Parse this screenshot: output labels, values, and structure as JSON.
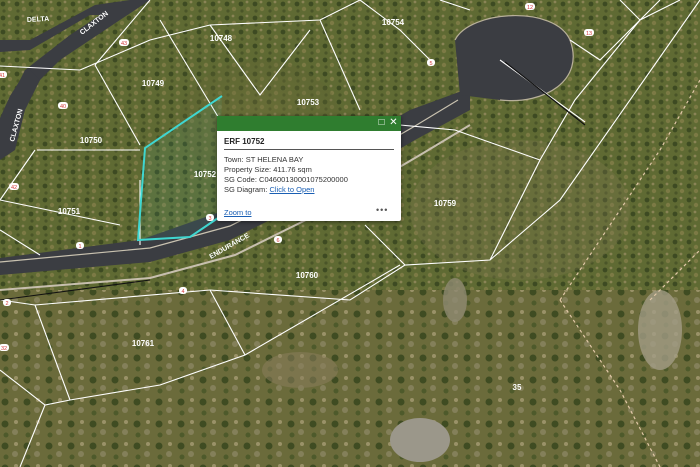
{
  "map": {
    "erf_labels": [
      "10754",
      "10748",
      "10749",
      "10753",
      "10750",
      "10751",
      "10759",
      "10760",
      "10761",
      "35",
      "10752"
    ],
    "street_names": [
      "DELTA",
      "CLAXTON",
      "CLAXTON",
      "ENDURANCE"
    ],
    "street_numbers": [
      "43",
      "40",
      "42",
      "41",
      "1",
      "3",
      "4",
      "6",
      "13",
      "5",
      "12",
      "2",
      "32"
    ],
    "selected_parcel_color": "#3fd6d0",
    "boundary_color": "#ffffff"
  },
  "popup": {
    "title": "ERF 10752",
    "town_label": "Town:",
    "town_value": "ST HELENA BAY",
    "size_label": "Property Size:",
    "size_value": "411.76 sqm",
    "sg_code_label": "SG Code:",
    "sg_code_value": "C04600130001075200000",
    "sg_diagram_label": "SG Diagram:",
    "sg_diagram_link": "Click to Open",
    "zoom_link": "Zoom to",
    "more_icon": "•••",
    "header_color": "#2f7d2f"
  }
}
